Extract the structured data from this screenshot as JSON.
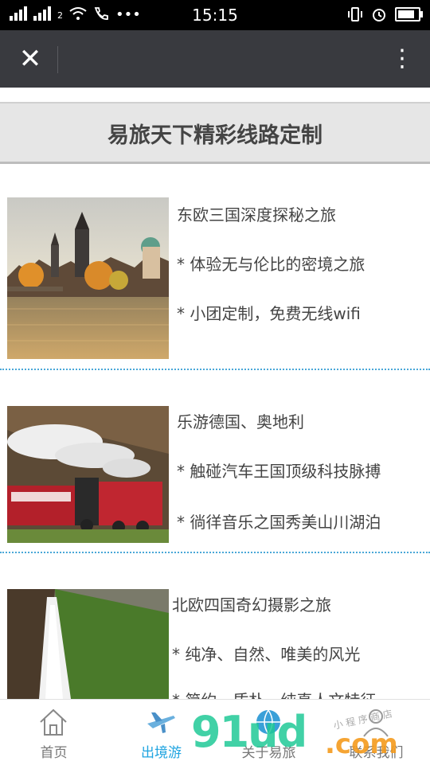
{
  "statusbar": {
    "time": "15:15",
    "network_label": "2"
  },
  "header": {
    "close_icon": "close-icon",
    "menu_icon": "more-vertical-icon"
  },
  "page": {
    "title": "易旅天下精彩线路定制"
  },
  "routes": [
    {
      "name": "东欧三国深度探秘之旅",
      "features": [
        "* 体验无与伦比的密境之旅",
        "* 小团定制，免费无线wifi"
      ]
    },
    {
      "name": "乐游德国、奥地利",
      "features": [
        "* 触碰汽车王国顶级科技脉搏",
        "* 徜徉音乐之国秀美山川湖泊"
      ]
    },
    {
      "name": "北欧四国奇幻摄影之旅",
      "features": [
        "* 纯净、自然、唯美的风光",
        "* 简约、质朴、纯真人文特征"
      ]
    }
  ],
  "nav": [
    {
      "label": "首页",
      "icon": "home-icon"
    },
    {
      "label": "出境游",
      "icon": "airplane-icon",
      "active": true
    },
    {
      "label": "关于易旅",
      "icon": "globe-icon"
    },
    {
      "label": "联系我们",
      "icon": "user-icon"
    }
  ],
  "watermark": {
    "text1": "9",
    "text2": "1ud",
    "text3": ".com",
    "tag": "小 程 序 商 店"
  }
}
